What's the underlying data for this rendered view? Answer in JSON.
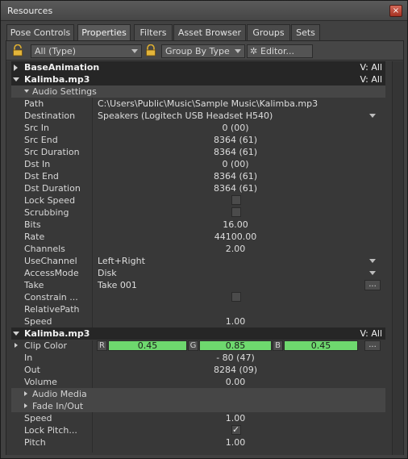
{
  "window": {
    "title": "Resources",
    "close_glyph": "×"
  },
  "tabs": [
    "Pose Controls",
    "Properties",
    "Filters",
    "Asset Browser",
    "Groups",
    "Sets"
  ],
  "active_tab": "Properties",
  "toolbar": {
    "type_filter": "All (Type)",
    "group_by": "Group By Type",
    "editor_label": "Editor...",
    "gear_glyph": "✲"
  },
  "sections": {
    "base_animation": {
      "name": "BaseAnimation",
      "v": "V: All"
    },
    "kalimba_1": {
      "name": "Kalimba.mp3",
      "v": "V: All"
    },
    "audio_settings": "Audio Settings",
    "kalimba_2": {
      "name": "Kalimba.mp3",
      "v": "V: All"
    },
    "audio_media": "Audio Media",
    "fade_in_out": "Fade In/Out"
  },
  "audio_props": {
    "path": {
      "label": "Path",
      "value": "C:\\Users\\Public\\Music\\Sample Music\\Kalimba.mp3"
    },
    "destination": {
      "label": "Destination",
      "value": "Speakers (Logitech USB Headset H540)"
    },
    "src_in": {
      "label": "Src In",
      "value": "0 (00)"
    },
    "src_end": {
      "label": "Src End",
      "value": "8364 (61)"
    },
    "src_duration": {
      "label": "Src Duration",
      "value": "8364 (61)"
    },
    "dst_in": {
      "label": "Dst In",
      "value": "0 (00)"
    },
    "dst_end": {
      "label": "Dst End",
      "value": "8364 (61)"
    },
    "dst_duration": {
      "label": "Dst Duration",
      "value": "8364 (61)"
    },
    "lock_speed": {
      "label": "Lock Speed",
      "checked": false
    },
    "scrubbing": {
      "label": "Scrubbing",
      "checked": false
    },
    "bits": {
      "label": "Bits",
      "value": "16.00"
    },
    "rate": {
      "label": "Rate",
      "value": "44100.00"
    },
    "channels": {
      "label": "Channels",
      "value": "2.00"
    },
    "use_channel": {
      "label": "UseChannel",
      "value": "Left+Right"
    },
    "access_mode": {
      "label": "AccessMode",
      "value": "Disk"
    },
    "take": {
      "label": "Take",
      "value": "Take 001",
      "button": "..."
    },
    "constrain": {
      "label": "Constrain ...",
      "checked": false
    },
    "relative_path": {
      "label": "RelativePath",
      "value": ""
    },
    "speed": {
      "label": "Speed",
      "value": "1.00"
    }
  },
  "clip_props": {
    "clip_color": {
      "label": "Clip Color",
      "r_label": "R",
      "g_label": "G",
      "b_label": "B",
      "r": "0.45",
      "g": "0.85",
      "b": "0.45",
      "button": "...",
      "swatch": "#6ed86e"
    },
    "in": {
      "label": "In",
      "value": "- 80 (47)"
    },
    "out": {
      "label": "Out",
      "value": "8284 (09)"
    },
    "volume": {
      "label": "Volume",
      "value": "0.00"
    },
    "speed": {
      "label": "Speed",
      "value": "1.00"
    },
    "lock_pitch": {
      "label": "Lock Pitch...",
      "checked": true,
      "glyph": "✓"
    },
    "pitch": {
      "label": "Pitch",
      "value": "1.00"
    }
  }
}
